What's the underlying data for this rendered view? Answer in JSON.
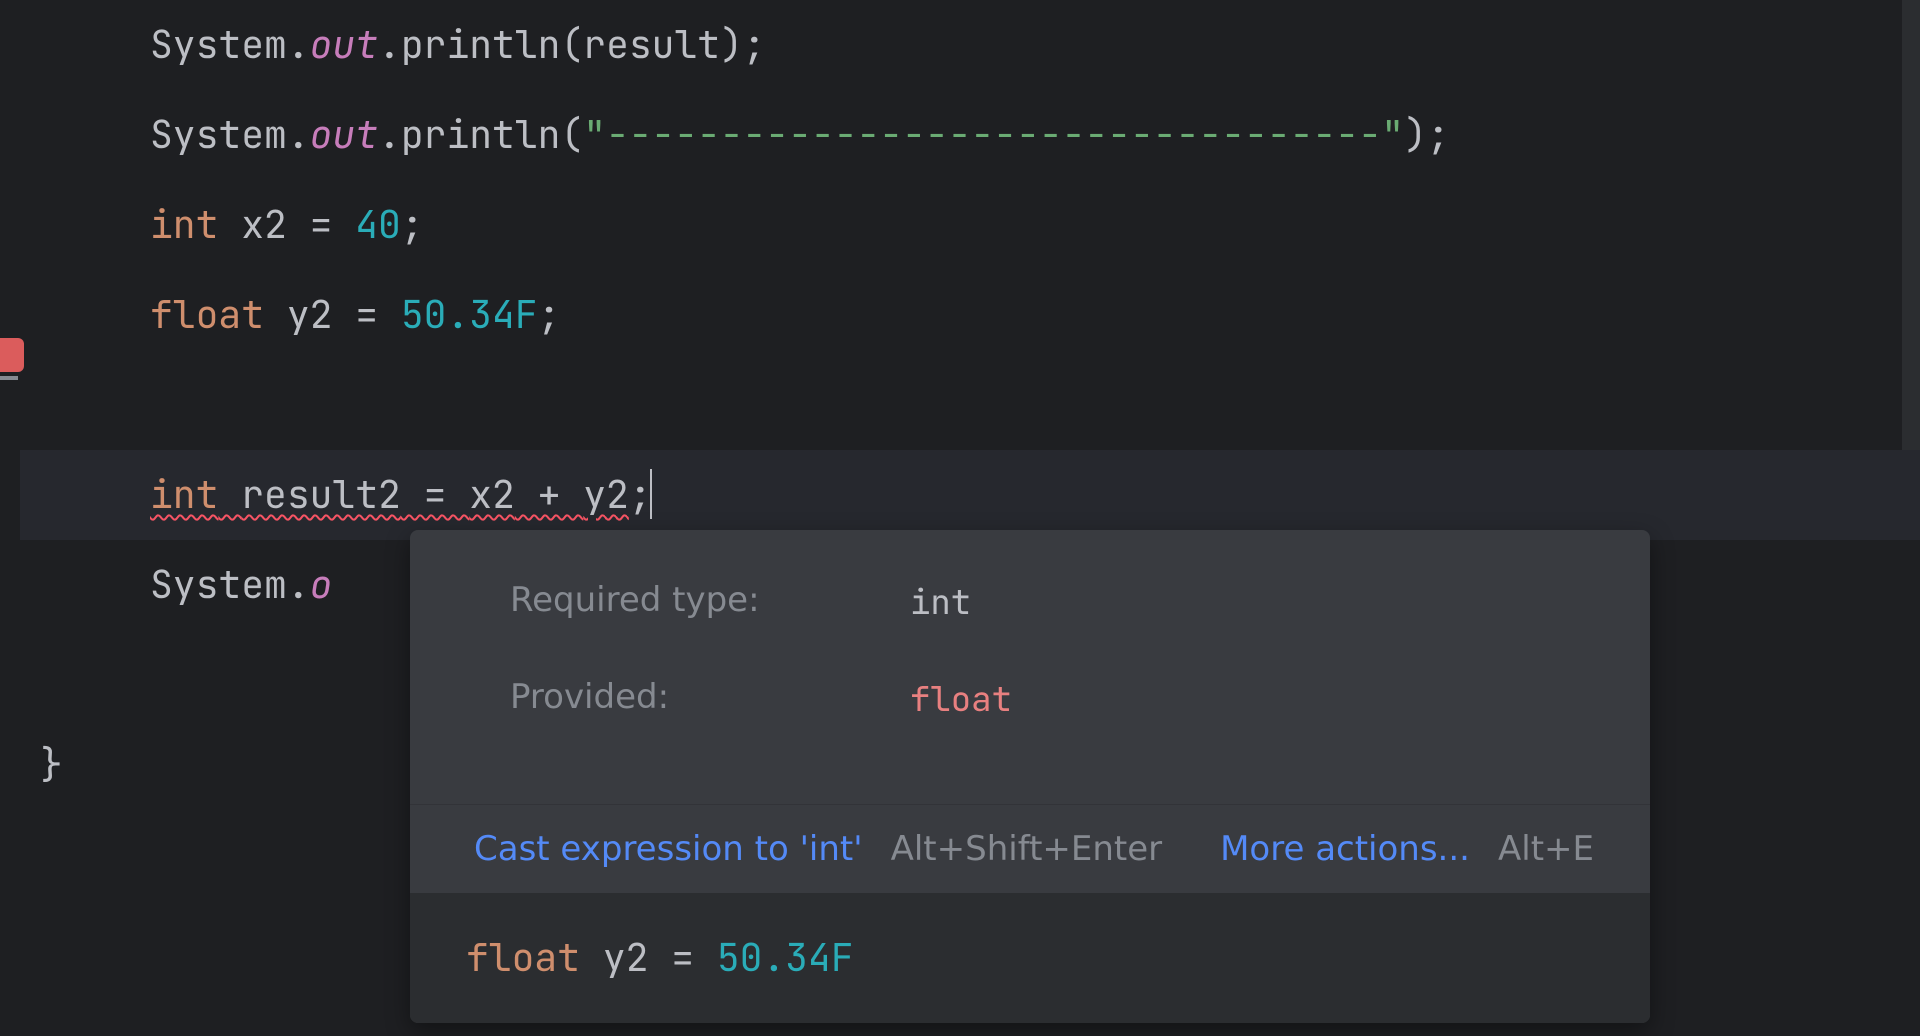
{
  "code": {
    "line1": {
      "class": "System",
      "dot1": ".",
      "field": "out",
      "dot2": ".",
      "method": "println",
      "open": "(",
      "arg": "result",
      "close": ")",
      "semi": ";"
    },
    "line2": {
      "class": "System",
      "dot1": ".",
      "field": "out",
      "dot2": ".",
      "method": "println",
      "open": "(",
      "str": "\"----------------------------------\"",
      "close": ")",
      "semi": ";"
    },
    "line3": {
      "type": "int",
      "sp1": " ",
      "ident": "x2",
      "eq": " = ",
      "num": "40",
      "semi": ";"
    },
    "line4": {
      "type": "float",
      "sp1": " ",
      "ident": "y2",
      "eq": " = ",
      "num": "50.34F",
      "semi": ";"
    },
    "line6": {
      "type": "int",
      "sp1": " ",
      "ident": "result2",
      "eq": " = ",
      "expr1": "x2",
      "plus": " + ",
      "expr2": "y2",
      "semi": ";"
    },
    "line7": {
      "class": "System",
      "dot1": ".",
      "partial": "o"
    },
    "line9": {
      "brace": "}"
    }
  },
  "tooltip": {
    "requiredLabel": "Required type:",
    "requiredValue": "int",
    "providedLabel": "Provided:",
    "providedValue": "float",
    "action1": "Cast expression to 'int'",
    "shortcut1": "Alt+Shift+Enter",
    "action2": "More actions...",
    "shortcut2": "Alt+E",
    "snippet": {
      "type": "float",
      "sp": " ",
      "ident": "y2",
      "eq": " = ",
      "num": "50.34F"
    }
  }
}
